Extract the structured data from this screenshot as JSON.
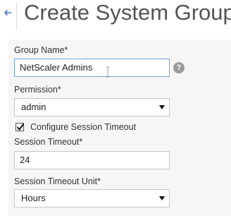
{
  "header": {
    "title": "Create System Group",
    "back_icon": "arrow-left-icon"
  },
  "form": {
    "group_name": {
      "label": "Group Name*",
      "value": "NetScaler Admins",
      "help_icon": "question-icon",
      "help_glyph": "?"
    },
    "permission": {
      "label": "Permission*",
      "selected": "admin"
    },
    "configure_timeout": {
      "label": "Configure Session Timeout",
      "checked": true
    },
    "session_timeout": {
      "label": "Session Timeout*",
      "value": "24"
    },
    "session_timeout_unit": {
      "label": "Session Timeout Unit*",
      "selected": "Hours"
    }
  },
  "colors": {
    "accent": "#6fa3dc",
    "panel_bg": "#f6f6f6",
    "title_text": "#545454"
  }
}
